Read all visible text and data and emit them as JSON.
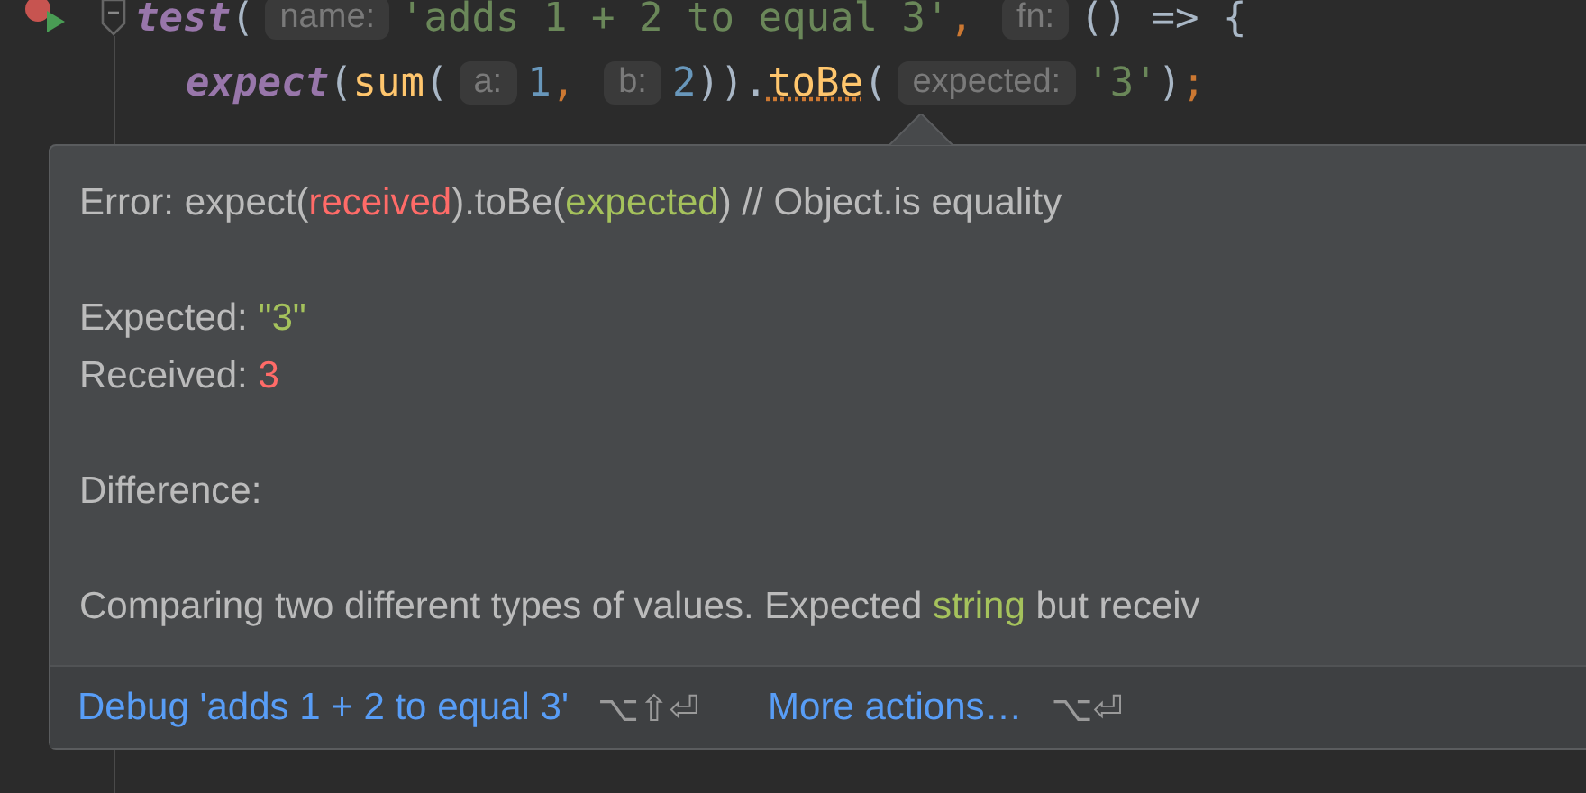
{
  "editor": {
    "lines": [
      {
        "run_marker": true,
        "fold": true,
        "indent": false,
        "tokens": [
          {
            "kind": "call",
            "text": "test"
          },
          {
            "kind": "plain",
            "text": "("
          },
          {
            "kind": "hint",
            "text": "name:"
          },
          {
            "kind": "string",
            "text": "'adds 1 + 2 to equal 3'"
          },
          {
            "kind": "punct",
            "text": ","
          },
          {
            "kind": "hint",
            "text": "fn:"
          },
          {
            "kind": "plain",
            "text": "() => {"
          }
        ]
      },
      {
        "run_marker": false,
        "fold": false,
        "indent": true,
        "tokens": [
          {
            "kind": "call",
            "text": "expect"
          },
          {
            "kind": "plain",
            "text": "("
          },
          {
            "kind": "method",
            "text": "sum"
          },
          {
            "kind": "plain",
            "text": "("
          },
          {
            "kind": "hint",
            "text": "a:"
          },
          {
            "kind": "number",
            "text": "1"
          },
          {
            "kind": "punct",
            "text": ","
          },
          {
            "kind": "hint",
            "text": "b:"
          },
          {
            "kind": "number",
            "text": "2"
          },
          {
            "kind": "plain",
            "text": "))."
          },
          {
            "kind": "warning",
            "text": "toBe"
          },
          {
            "kind": "plain",
            "text": "("
          },
          {
            "kind": "hint",
            "text": "expected:"
          },
          {
            "kind": "string",
            "text": "'3'"
          },
          {
            "kind": "plain",
            "text": ")"
          },
          {
            "kind": "punct",
            "text": ";"
          }
        ]
      }
    ]
  },
  "popup": {
    "paragraphs": [
      [
        [
          {
            "kind": "text",
            "text": "Error: expect("
          },
          {
            "kind": "received",
            "text": "received"
          },
          {
            "kind": "text",
            "text": ").toBe("
          },
          {
            "kind": "expected",
            "text": "expected"
          },
          {
            "kind": "text",
            "text": ") // Object.is equality"
          }
        ]
      ],
      [
        [
          {
            "kind": "text",
            "text": "Expected: "
          },
          {
            "kind": "expected",
            "text": "\"3\""
          }
        ],
        [
          {
            "kind": "text",
            "text": "Received: "
          },
          {
            "kind": "received",
            "text": "3"
          }
        ]
      ],
      [
        [
          {
            "kind": "text",
            "text": "Difference:"
          }
        ]
      ],
      [
        [
          {
            "kind": "text",
            "text": "Comparing two different types of values. Expected "
          },
          {
            "kind": "expected",
            "text": "string"
          },
          {
            "kind": "text",
            "text": " but receiv"
          }
        ]
      ]
    ],
    "actions": [
      {
        "label": "Debug 'adds 1 + 2 to equal 3'",
        "shortcut": "⌥⇧⏎"
      },
      {
        "label": "More actions…",
        "shortcut": "⌥⏎"
      }
    ]
  }
}
